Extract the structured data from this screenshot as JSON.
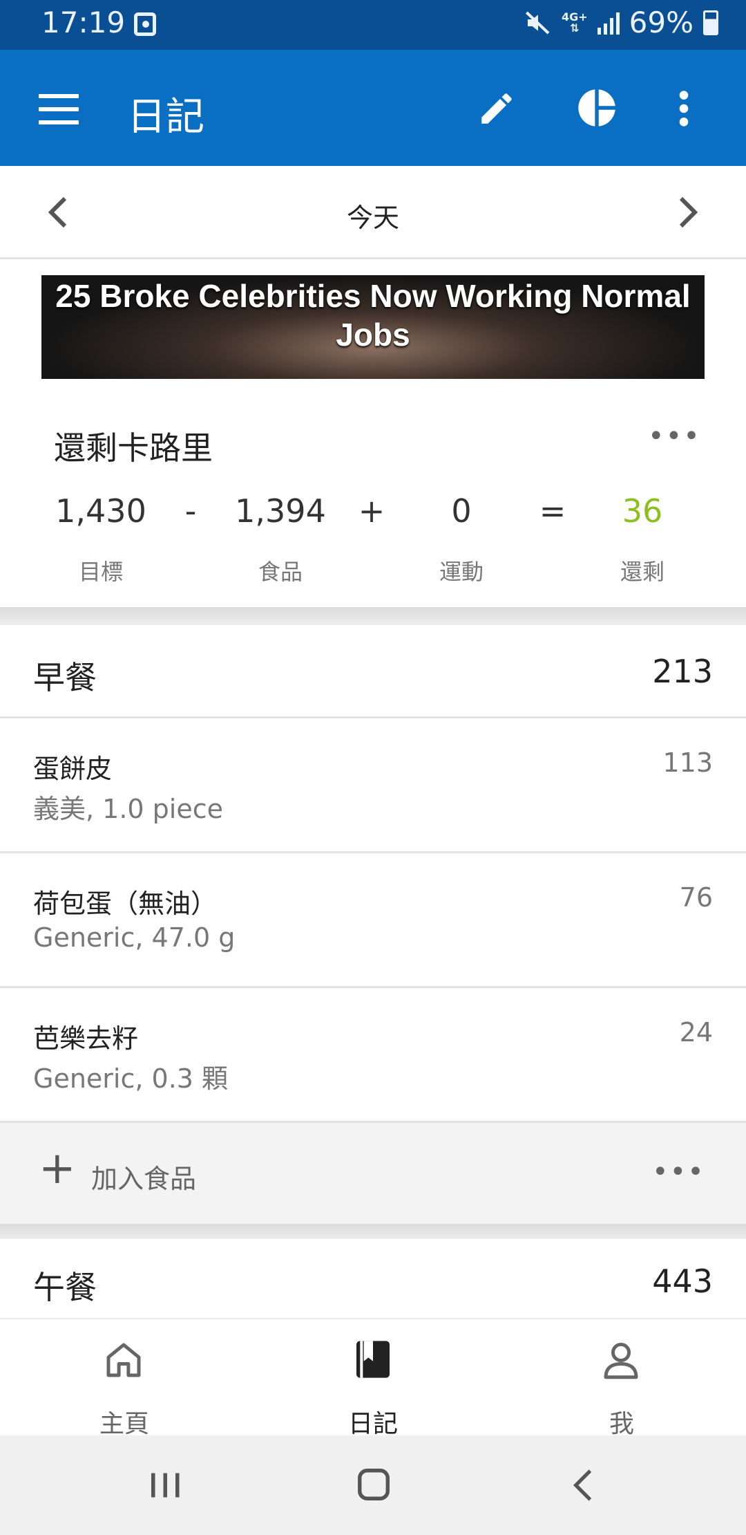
{
  "status_bar": {
    "time": "17:19",
    "network": "4G+",
    "battery": "69%",
    "icons": [
      "alarm-icon",
      "mute-icon",
      "signal-icon",
      "battery-icon"
    ]
  },
  "app_bar": {
    "title": "日記",
    "icons": [
      "menu-icon",
      "edit-icon",
      "pie-chart-icon",
      "more-vert-icon"
    ],
    "color": "#0a6fc2"
  },
  "date_nav": {
    "label": "今天"
  },
  "ad": {
    "text": "25 Broke Celebrities Now Working Normal Jobs"
  },
  "calories": {
    "title": "還剩卡路里",
    "goal": {
      "value": "1,430",
      "label": "目標"
    },
    "op1": "-",
    "food": {
      "value": "1,394",
      "label": "食品"
    },
    "op2": "+",
    "exercise": {
      "value": "0",
      "label": "運動"
    },
    "op3": "=",
    "remaining": {
      "value": "36",
      "label": "還剩",
      "color": "#8cbf1f"
    }
  },
  "breakfast": {
    "name": "早餐",
    "calories": "213",
    "items": [
      {
        "name": "蛋餅皮",
        "desc": "義美, 1.0 piece",
        "calories": "113"
      },
      {
        "name": "荷包蛋（無油）",
        "desc": "Generic, 47.0 g",
        "calories": "76"
      },
      {
        "name": "芭樂去籽",
        "desc": "Generic, 0.3 顆",
        "calories": "24"
      }
    ],
    "add_label": "加入食品"
  },
  "lunch": {
    "name": "午餐",
    "calories": "443"
  },
  "bottom_nav": {
    "tabs": [
      {
        "label": "主頁",
        "icon": "home-icon"
      },
      {
        "label": "日記",
        "icon": "diary-icon",
        "active": true
      },
      {
        "label": "我",
        "icon": "profile-icon"
      }
    ]
  },
  "system_nav": {
    "icons": [
      "recents-icon",
      "home-button-icon",
      "back-icon"
    ]
  }
}
